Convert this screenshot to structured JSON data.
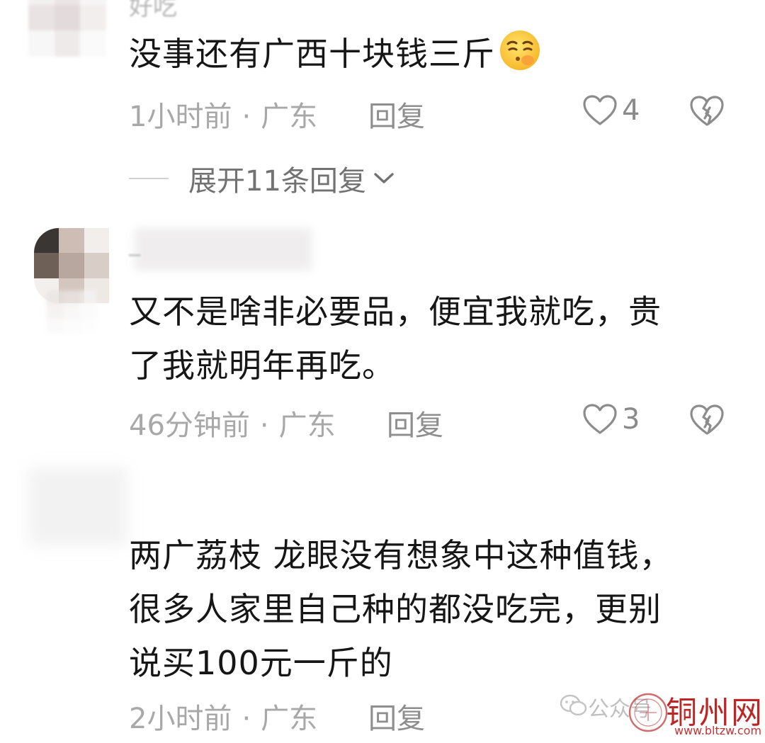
{
  "top_partial_username": "好吃",
  "comments": [
    {
      "text_lines": [
        "没事还有广西十块钱三斤"
      ],
      "emoji": "shushing-face-emoji",
      "time": "1小时前",
      "separator": "·",
      "location": "广东",
      "reply_label": "回复",
      "like_count": "4",
      "expand_label": "展开11条回复"
    },
    {
      "username_partial": "_",
      "text_lines": [
        "又不是啥非必要品，便宜我就吃，贵",
        "了我就明年再吃。"
      ],
      "time": "46分钟前",
      "separator": "·",
      "location": "广东",
      "reply_label": "回复",
      "like_count": "3"
    },
    {
      "text_lines": [
        "两广荔枝 龙眼没有想象中这种值钱，",
        "很多人家里自己种的都没吃完，更别",
        "说买100元一斤的"
      ],
      "time": "2小时前",
      "separator": "·",
      "location": "广东",
      "reply_label": "回复"
    }
  ],
  "watermark": {
    "wechat_label": "公众号",
    "brand": "铜州网",
    "url": "www.bltzw.com"
  },
  "colors": {
    "text_primary": "#161616",
    "text_meta": "#a8a8a8",
    "reply": "#8e8e8e",
    "watermark_red": "#b30000"
  }
}
